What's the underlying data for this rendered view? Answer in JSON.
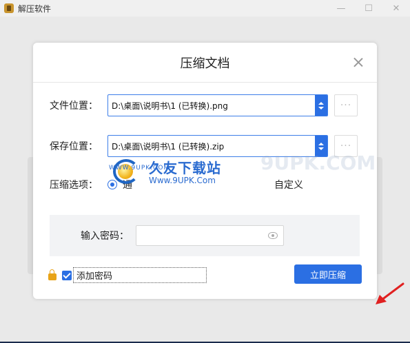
{
  "app": {
    "title": "解压软件",
    "window_controls": [
      "—",
      "☐",
      "✕"
    ]
  },
  "dialog": {
    "title": "压缩文档",
    "file_location": {
      "label": "文件位置：",
      "value": "D:\\桌面\\说明书\\1 (已转换).png",
      "more": "···"
    },
    "save_location": {
      "label": "保存位置：",
      "value": "D:\\桌面\\说明书\\1 (已转换).zip",
      "more": "···"
    },
    "compress_options": {
      "label": "压缩选项：",
      "option_default": "通",
      "option_custom": "自定义"
    },
    "password": {
      "label": "输入密码：",
      "placeholder": ""
    },
    "add_password_label": "添加密码",
    "submit_label": "立即压缩"
  },
  "watermark": {
    "small": "WWW.9UPK.COM",
    "cn": "久友下载站",
    "url": "Www.9UPK.Com",
    "ghost": "9UPK.COM"
  },
  "colors": {
    "accent": "#2b6fe3",
    "lock": "#e8a317",
    "arrow": "#e02020"
  }
}
